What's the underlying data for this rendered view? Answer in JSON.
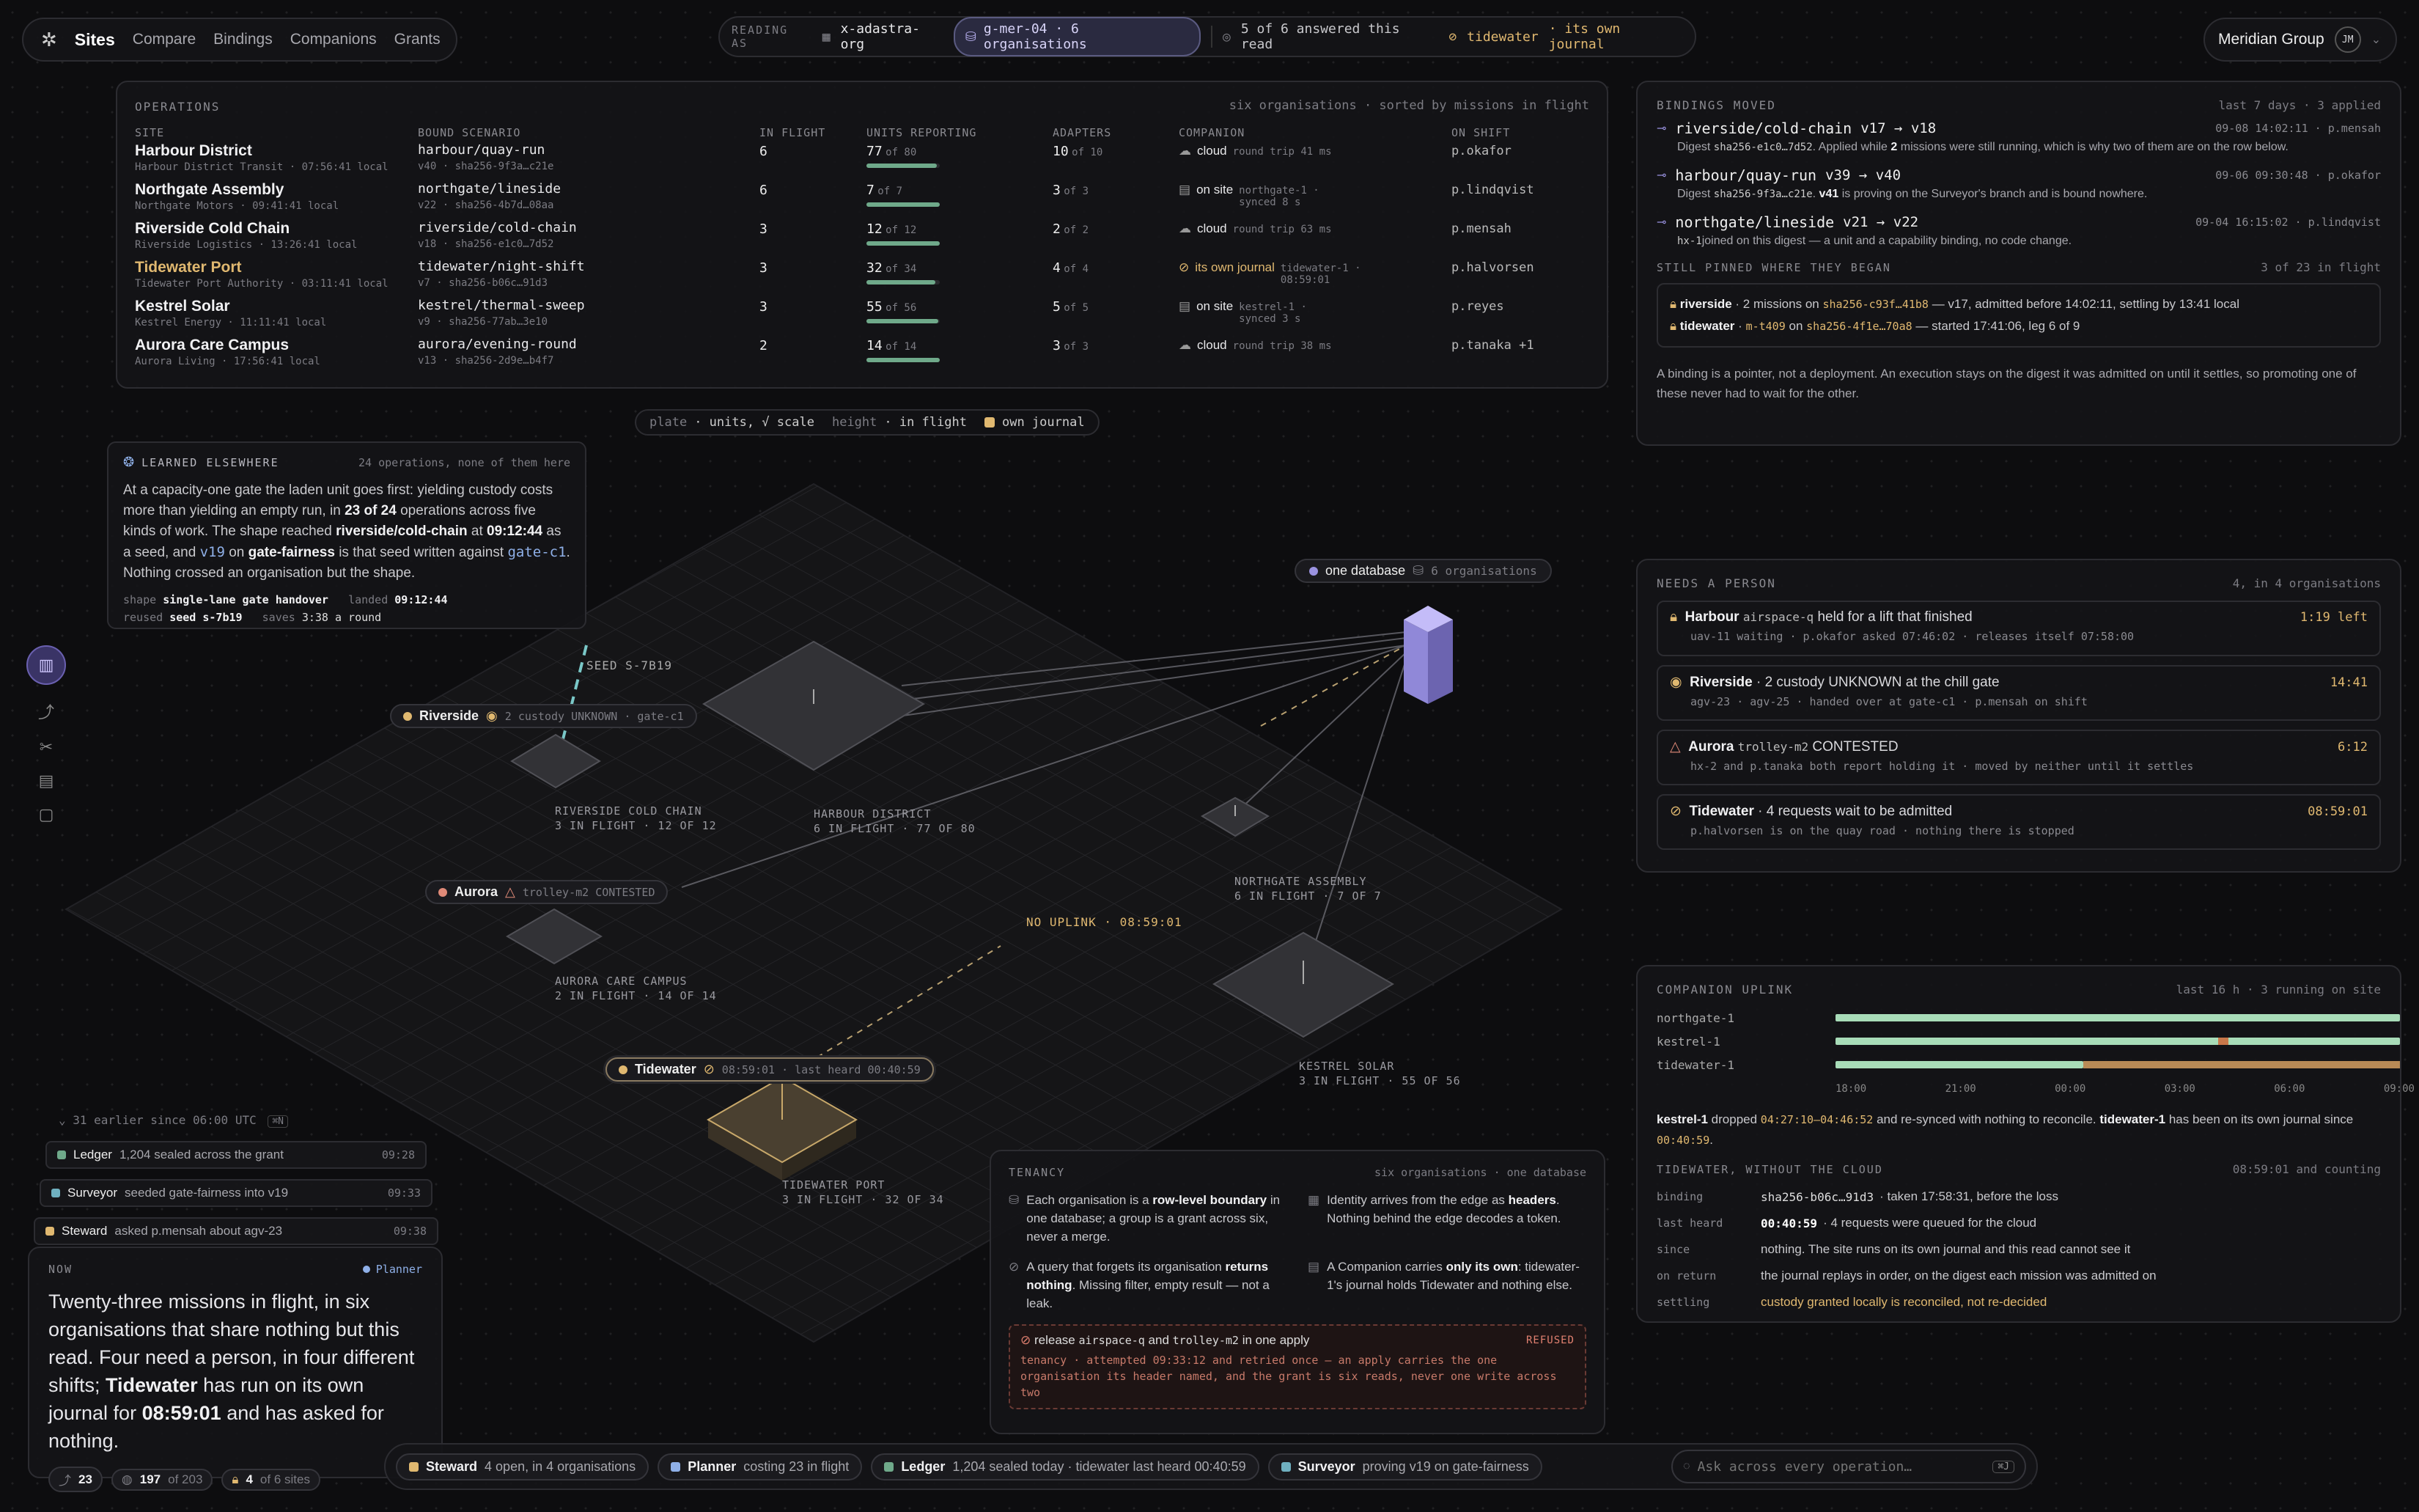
{
  "nav": {
    "sites": "Sites",
    "compare": "Compare",
    "bindings": "Bindings",
    "companions": "Companions",
    "grants": "Grants"
  },
  "reading": {
    "label": "READING AS",
    "org": "x-adastra-org",
    "group": "g-mer-04 · 6 organisations",
    "answered": "5 of 6 answered this read",
    "tidewater": "tidewater",
    "journal": "· its own journal"
  },
  "account": {
    "name": "Meridian Group",
    "initials": "JM"
  },
  "ops": {
    "title": "OPERATIONS",
    "meta": "six organisations · sorted by missions in flight",
    "headers": [
      "SITE",
      "BOUND SCENARIO",
      "IN FLIGHT",
      "UNITS REPORTING",
      "ADAPTERS",
      "COMPANION",
      "ON SHIFT"
    ],
    "rows": [
      {
        "site": "Harbour District",
        "sub": "Harbour District Transit · 07:56:41 local",
        "scen": "harbour/quay-run",
        "ver": "v40 · sha256-9f3a…c21e",
        "inflight": "6",
        "units": "77",
        "unitsOf": "of 80",
        "ad": "10",
        "adOf": "of 10",
        "comp": "cloud",
        "compSub": "round trip 41 ms",
        "shift": "p.okafor",
        "fill": 0.96,
        "c1": "",
        "c2": ""
      },
      {
        "site": "Northgate Assembly",
        "sub": "Northgate Motors · 09:41:41 local",
        "scen": "northgate/lineside",
        "ver": "v22 · sha256-4b7d…08aa",
        "inflight": "6",
        "units": "7",
        "unitsOf": "of 7",
        "ad": "3",
        "adOf": "of 3",
        "comp": "on site",
        "compSub": "northgate-1 · synced 8 s",
        "shift": "p.lindqvist",
        "fill": 1.0,
        "c1": "",
        "c2": ""
      },
      {
        "site": "Riverside Cold Chain",
        "sub": "Riverside Logistics · 13:26:41 local",
        "scen": "riverside/cold-chain",
        "ver": "v18 · sha256-e1c0…7d52",
        "inflight": "3",
        "units": "12",
        "unitsOf": "of 12",
        "ad": "2",
        "adOf": "of 2",
        "comp": "cloud",
        "compSub": "round trip 63 ms",
        "shift": "p.mensah",
        "fill": 1.0,
        "c1": "",
        "c2": ""
      },
      {
        "site": "Tidewater Port",
        "sub": "Tidewater Port Authority · 03:11:41 local",
        "scen": "tidewater/night-shift",
        "ver": "v7 · sha256-b06c…91d3",
        "inflight": "3",
        "units": "32",
        "unitsOf": "of 34",
        "ad": "4",
        "adOf": "of 4",
        "comp": "its own journal",
        "compSub": "tidewater-1 · 08:59:01",
        "shift": "p.halvorsen",
        "fill": 0.94,
        "c1": "#e0b870",
        "c2": "#e0b870"
      },
      {
        "site": "Kestrel Solar",
        "sub": "Kestrel Energy · 11:11:41 local",
        "scen": "kestrel/thermal-sweep",
        "ver": "v9 · sha256-77ab…3e10",
        "inflight": "3",
        "units": "55",
        "unitsOf": "of 56",
        "ad": "5",
        "adOf": "of 5",
        "comp": "on site",
        "compSub": "kestrel-1 · synced 3 s",
        "shift": "p.reyes",
        "fill": 0.98,
        "c1": "",
        "c2": ""
      },
      {
        "site": "Aurora Care Campus",
        "sub": "Aurora Living · 17:56:41 local",
        "scen": "aurora/evening-round",
        "ver": "v13 · sha256-2d9e…b4f7",
        "inflight": "2",
        "units": "14",
        "unitsOf": "of 14",
        "ad": "3",
        "adOf": "of 3",
        "comp": "cloud",
        "compSub": "round trip 38 ms",
        "shift": "p.tanaka +1",
        "fill": 1.0,
        "c1": "",
        "c2": ""
      }
    ]
  },
  "legend": {
    "plate": "plate",
    "units": "· units, √ scale",
    "height": "height",
    "inflight": "· in flight",
    "journal": "own journal"
  },
  "learned": {
    "title": "LEARNED ELSEWHERE",
    "meta": "24 operations, none of them here",
    "p1": "At a capacity-one gate the laden unit goes first: yielding custody costs more than yielding an empty run, in",
    "p1b": "23 of 24",
    "p1c": "operations across five kinds of work. The shape reached",
    "p1d": "riverside/cold-chain",
    "p1e": "at",
    "p1f": "09:12:44",
    "p1g": "as a seed, and",
    "p1h": "v19",
    "p1i": "on",
    "p1j": "gate-fairness",
    "p1k": "is that seed written against",
    "p1l": "gate-c1",
    "p1m": ". Nothing crossed an organisation but the shape.",
    "shapeL": "shape",
    "shapeV": "single-lane gate handover",
    "landedL": "landed",
    "landedV": "09:12:44",
    "reusedL": "reused",
    "reusedV": "seed s-7b19",
    "savesL": "saves",
    "savesV": "3:38 a round"
  },
  "map": {
    "seed": "SEED S-7B19",
    "noUplink": "NO UPLINK · 08:59:01",
    "db": "one database",
    "dbOrgs": "6 organisations",
    "riverside": {
      "name": "Riverside",
      "detail": "2 custody UNKNOWN · gate-c1",
      "l1": "RIVERSIDE COLD CHAIN",
      "l2": "3 IN FLIGHT · 12 OF 12"
    },
    "harbour": {
      "l1": "HARBOUR DISTRICT",
      "l2": "6 IN FLIGHT · 77 OF 80"
    },
    "northgate": {
      "l1": "NORTHGATE ASSEMBLY",
      "l2": "6 IN FLIGHT · 7 OF 7"
    },
    "aurora": {
      "name": "Aurora",
      "detail": "trolley-m2 CONTESTED",
      "l1": "AURORA CARE CAMPUS",
      "l2": "2 IN FLIGHT · 14 OF 14"
    },
    "kestrel": {
      "l1": "KESTREL SOLAR",
      "l2": "3 IN FLIGHT · 55 OF 56"
    },
    "tidewater": {
      "name": "Tidewater",
      "detail": "08:59:01 · last heard 00:40:59",
      "l1": "TIDEWATER PORT",
      "l2": "3 IN FLIGHT · 32 OF 34"
    }
  },
  "bindings": {
    "title": "BINDINGS MOVED",
    "meta": "last 7 days · 3 applied",
    "items": [
      {
        "name": "riverside/cold-chain",
        "ver": "v17 → v18",
        "when": "09-08 14:02:11 · p.mensah",
        "d1": "Digest",
        "d2": "sha256-e1c0…7d52",
        "d3": ". Applied while",
        "d4": "2",
        "d5": "missions were still running, which is why two of them are on the row below."
      },
      {
        "name": "harbour/quay-run",
        "ver": "v39 → v40",
        "when": "09-06 09:30:48 · p.okafor",
        "d1": "Digest",
        "d2": "sha256-9f3a…c21e",
        "d3": ".",
        "d4": "v41",
        "d5": "is proving on the Surveyor's branch and is bound nowhere."
      },
      {
        "name": "northgate/lineside",
        "ver": "v21 → v22",
        "when": "09-04 16:15:02 · p.lindqvist",
        "d1": "",
        "d2": "hx-1",
        "d3": "joined on this digest — a unit and a capability binding, no code change.",
        "d4": "",
        "d5": ""
      }
    ],
    "pinnedTitle": "STILL PINNED WHERE THEY BEGAN",
    "pinnedMeta": "3 of 23 in flight",
    "p1a": "riverside",
    "p1b": "· 2 missions on",
    "p1c": "sha256-c93f…41b8",
    "p1d": "— v17, admitted before 14:02:11, settling by 13:41 local",
    "p2a": "tidewater",
    "p2b": "·",
    "p2c": "m-t409",
    "p2d": "on",
    "p2e": "sha256-4f1e…70a8",
    "p2f": "— started 17:41:06, leg 6 of 9",
    "foot": "A binding is a pointer, not a deployment. An execution stays on the digest it was admitted on until it settles, so promoting one of these never had to wait for the other."
  },
  "needs": {
    "title": "NEEDS A PERSON",
    "meta": "4, in 4 organisations",
    "items": [
      {
        "name": "Harbour",
        "code": "airspace-q",
        "rest": "held for a lift that finished",
        "time": "1:19 left",
        "sub": "uav-11 waiting · p.okafor asked 07:46:02 · releases itself 07:58:00"
      },
      {
        "name": "Riverside",
        "code": "",
        "rest": "· 2 custody UNKNOWN at the chill gate",
        "time": "14:41",
        "sub": "agv-23 · agv-25 · handed over at gate-c1 · p.mensah on shift"
      },
      {
        "name": "Aurora",
        "code": "trolley-m2",
        "rest": "CONTESTED",
        "time": "6:12",
        "sub": "hx-2 and p.tanaka both report holding it · moved by neither until it settles"
      },
      {
        "name": "Tidewater",
        "code": "",
        "rest": "· 4 requests wait to be admitted",
        "time": "08:59:01",
        "sub": "p.halvorsen is on the quay road · nothing there is stopped"
      }
    ]
  },
  "uplink": {
    "title": "COMPANION UPLINK",
    "meta": "last 16 h · 3 running on site",
    "rows": [
      "northgate-1",
      "kestrel-1",
      "tidewater-1"
    ],
    "ticks": [
      "18:00",
      "21:00",
      "00:00",
      "03:00",
      "06:00",
      "09:00"
    ],
    "n1": "kestrel-1",
    "n2": "dropped",
    "n3": "04:27:10–04:46:52",
    "n4": "and re-synced with nothing to reconcile.",
    "n5": "tidewater-1",
    "n6": "has been on its own journal since",
    "n7": "00:40:59",
    "twTitle": "TIDEWATER, WITHOUT THE CLOUD",
    "twMeta": "08:59:01 and counting",
    "kv": [
      {
        "k": "binding",
        "v1": "sha256-b06c…91d3",
        "v2": "· taken 17:58:31, before the loss"
      },
      {
        "k": "last heard",
        "v1": "00:40:59",
        "v2": "· 4 requests were queued for the cloud"
      },
      {
        "k": "since",
        "v1": "",
        "v2": "nothing. The site runs on its own journal and this read cannot see it"
      },
      {
        "k": "on return",
        "v1": "",
        "v2": "the journal replays in order, on the digest each mission was admitted on"
      },
      {
        "k": "settling",
        "v1": "",
        "v2": "custody granted locally is reconciled, not re-decided"
      }
    ]
  },
  "tenancy": {
    "title": "TENANCY",
    "meta": "six organisations · one database",
    "a1": "Each organisation is a",
    "a2": "row-level boundary",
    "a3": "in one database; a group is a grant across six, never a merge.",
    "b1": "Identity arrives from the edge as",
    "b2": "headers",
    "b3": ". Nothing behind the edge decodes a token.",
    "c1": "A query that forgets its organisation",
    "c2": "returns nothing",
    "c3": ". Missing filter, empty result — not a leak.",
    "d1": "A Companion carries",
    "d2": "only its own",
    "d3": ": tidewater-1's journal holds Tidewater and nothing else.",
    "r1": "release",
    "r2": "airspace-q",
    "r3": "and",
    "r4": "trolley-m2",
    "r5": "in one apply",
    "refused": "REFUSED",
    "r6": "tenancy · attempted 09:33:12 and retried once — an apply carries the one organisation its header named, and the grant is six reads, never one write across two"
  },
  "feed": {
    "earlier": "31 earlier since 06:00 UTC",
    "key": "⌘N",
    "items": [
      {
        "name": "Ledger",
        "text": "1,204 sealed across the grant",
        "time": "09:28",
        "color": "#6fa98a"
      },
      {
        "name": "Surveyor",
        "text": "seeded gate-fairness into v19",
        "time": "09:33",
        "color": "#6fb0c0"
      },
      {
        "name": "Steward",
        "text": "asked p.mensah about agv-23",
        "time": "09:38",
        "color": "#e0b870"
      }
    ]
  },
  "now": {
    "title": "NOW",
    "agent": "Planner",
    "t1": "Twenty-three missions in flight, in six organisations that share nothing but this read. Four need a person, in four different shifts;",
    "t2": "Tidewater",
    "t3": "has run on its own journal for",
    "t4": "08:59:01",
    "t5": "and has asked for nothing.",
    "s1": "23",
    "s2": "197",
    "s2b": "of 203",
    "s3": "4",
    "s3b": "of 6 sites"
  },
  "agents": [
    {
      "name": "Steward",
      "text": "4 open, in 4 organisations",
      "color": "#e0b870"
    },
    {
      "name": "Planner",
      "text": "costing 23 in flight",
      "color": "#8fb0e8"
    },
    {
      "name": "Ledger",
      "text": "1,204 sealed today · tidewater last heard 00:40:59",
      "color": "#6fa98a"
    },
    {
      "name": "Surveyor",
      "text": "proving v19 on gate-fairness",
      "color": "#6fb0c0"
    }
  ],
  "ask": {
    "placeholder": "Ask across every operation…",
    "key": "⌘J"
  }
}
